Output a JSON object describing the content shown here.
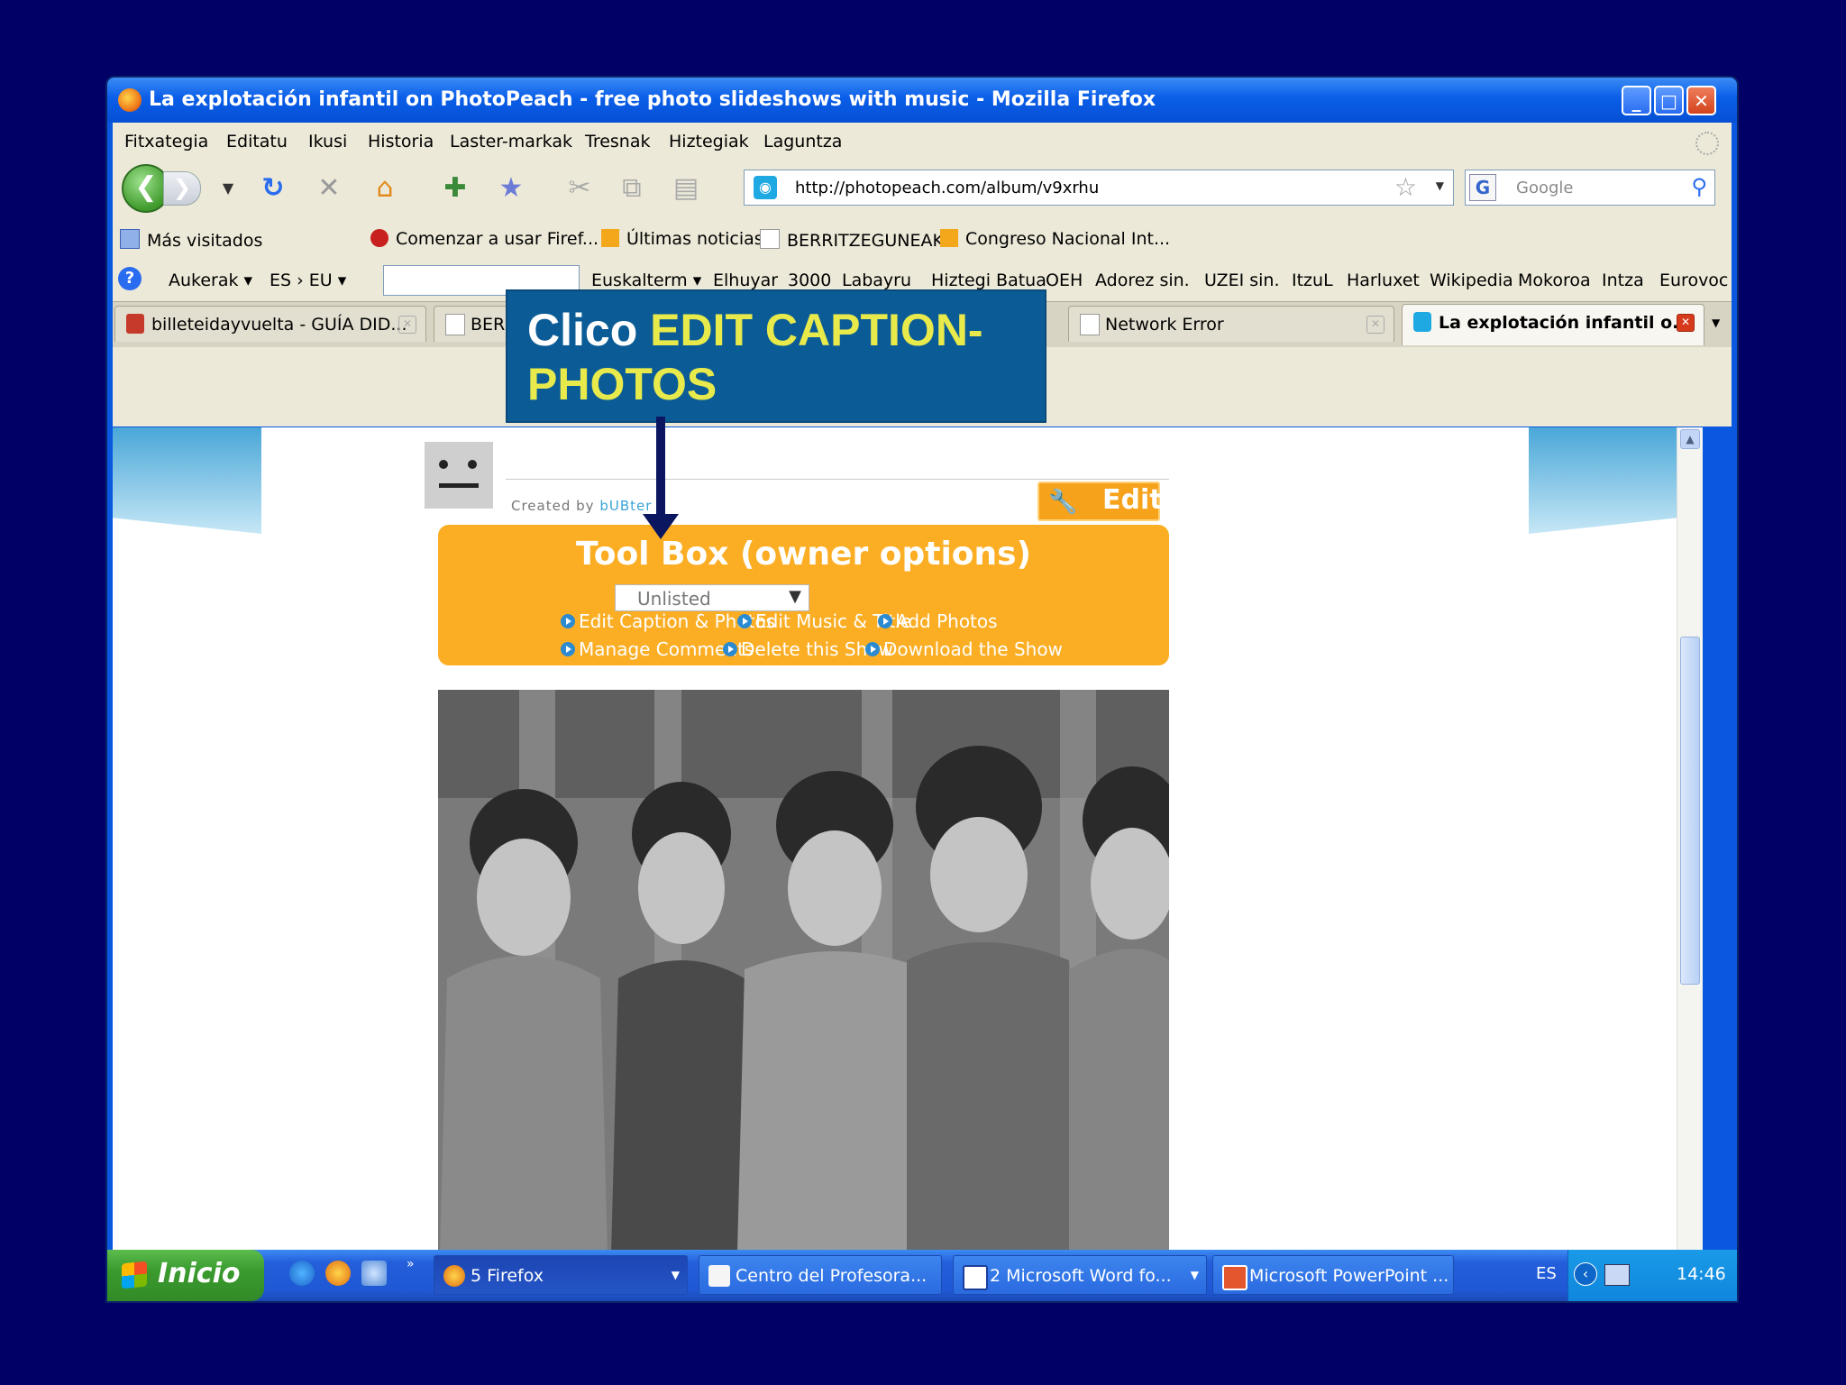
{
  "window": {
    "title": "La explotación infantil on PhotoPeach - free photo slideshows with music - Mozilla Firefox",
    "buttons": [
      "_",
      "□",
      "✕"
    ]
  },
  "menu": [
    "Fitxategia",
    "Editatu",
    "Ikusi",
    "Historia",
    "Laster-markak",
    "Tresnak",
    "Hiztegiak",
    "Laguntza"
  ],
  "nav": {
    "url": "http://photopeach.com/album/v9xrhu",
    "search_placeholder": "Google",
    "search_engine": "G"
  },
  "bookmarks": [
    "Más visitados",
    "Comenzar a usar Firef...",
    "Últimas noticias",
    "BERRITZEGUNEAK",
    "Congreso Nacional Int..."
  ],
  "toolbar2": {
    "aukerak": "Aukerak",
    "lang": "ES › EU",
    "links": [
      "Euskalterm",
      "Elhuyar",
      "3000",
      "Labayru",
      "Hiztegi Batua",
      "OEH",
      "Adorez sin.",
      "UZEI sin.",
      "ItzuL",
      "Harluxet",
      "Wikipedia",
      "Mokoroa",
      "Intza",
      "Eurovoc"
    ]
  },
  "tabs": [
    {
      "label": "billeteidayvuelta - GUÍA DID..."
    },
    {
      "label": "BER"
    },
    {
      "label": "Network Error"
    },
    {
      "label": "La explotación infantil o..."
    }
  ],
  "page": {
    "created_by": "Created by ",
    "created_by_user": "bUBter",
    "edit_label": "Edit",
    "toolbox_title": "Tool Box (owner options)",
    "visibility": "Unlisted",
    "links_row1": [
      "Edit Caption & Photos",
      "Edit Music & Title",
      "Add Photos"
    ],
    "links_row2": [
      "Manage Comments",
      "Delete this Show",
      "Download the Show"
    ]
  },
  "callout": {
    "prefix": "Clico ",
    "highlight1": "EDIT CAPTION-",
    "highlight2": "PHOTOS"
  },
  "taskbar": {
    "start": "Inicio",
    "tasks": [
      "5 Firefox",
      "Centro del Profesora...",
      "2 Microsoft Word fo...",
      "Microsoft PowerPoint ..."
    ],
    "lang": "ES",
    "clock": "14:46"
  },
  "colors": {
    "slide_bg": "#000066",
    "toolbox": "#fbae24",
    "callout_bg": "#0b5c96",
    "callout_highlight": "#e8ea4b"
  }
}
